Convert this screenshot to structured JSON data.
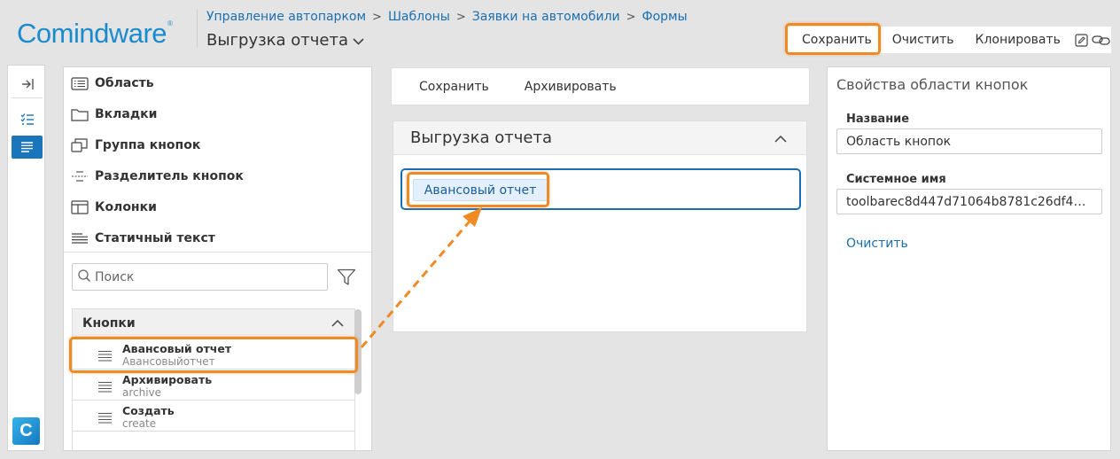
{
  "header": {
    "logo_text": "Comindware",
    "logo_mark": "®",
    "breadcrumb": [
      "Управление автопарком",
      "Шаблоны",
      "Заявки на автомобили",
      "Формы"
    ],
    "page_title": "Выгрузка отчета",
    "accent_color": "#1b75bb",
    "highlight_color": "#f08a24"
  },
  "top_toolbar": {
    "save_label": "Сохранить",
    "clear_label": "Очистить",
    "clone_label": "Клонировать",
    "icons": [
      "edit-icon",
      "link-icon"
    ]
  },
  "left_rail": {
    "icons": [
      "collapse-panel-icon",
      "checklist-icon",
      "form-list-icon"
    ],
    "app_icon_letter": "C"
  },
  "components": {
    "items": [
      {
        "icon": "area-icon",
        "label": "Область"
      },
      {
        "icon": "tabs-icon",
        "label": "Вкладки"
      },
      {
        "icon": "button-group-icon",
        "label": "Группа кнопок"
      },
      {
        "icon": "button-separator-icon",
        "label": "Разделитель кнопок"
      },
      {
        "icon": "columns-icon",
        "label": "Колонки"
      },
      {
        "icon": "static-text-icon",
        "label": "Статичный текст"
      }
    ],
    "search_placeholder": "Поиск",
    "list_header": "Кнопки",
    "list_items": [
      {
        "title": "Авансовый отчет",
        "subtitle": "Авансовыйотчет"
      },
      {
        "title": "Архивировать",
        "subtitle": "archive"
      },
      {
        "title": "Создать",
        "subtitle": "create"
      }
    ]
  },
  "form": {
    "toolbar": {
      "save_label": "Сохранить",
      "archive_label": "Архивировать"
    },
    "panel_title": "Выгрузка отчета",
    "button_area_item": "Авансовый отчет"
  },
  "properties": {
    "title": "Свойства области кнопок",
    "name_label": "Название",
    "name_value": "Область кнопок",
    "system_name_label": "Системное имя",
    "system_name_value": "toolbarec8d447d71064b8781c26df490…",
    "clear_label": "Очистить"
  }
}
